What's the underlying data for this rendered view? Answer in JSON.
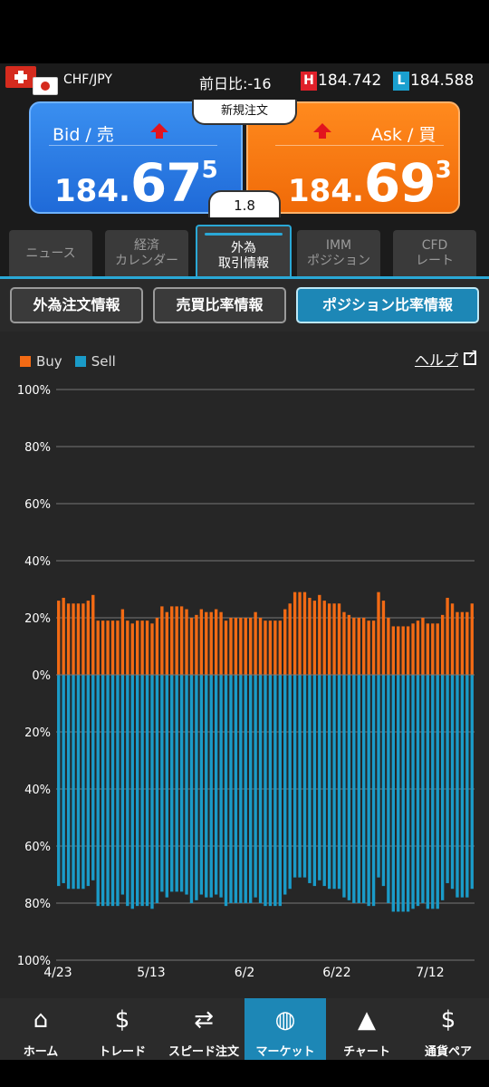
{
  "pair": {
    "name": "CHF/JPY",
    "change_label": "前日比:",
    "change_value": "-16",
    "high_badge": "H",
    "high": "184.742",
    "low_badge": "L",
    "low": "184.588"
  },
  "quote": {
    "bid_label": "Bid / 売",
    "bid_pre": "184.",
    "bid_big": "67",
    "bid_sup": "5",
    "ask_label": "Ask / 買",
    "ask_pre": "184.",
    "ask_big": "69",
    "ask_sup": "3",
    "new_order": "新規注文",
    "spread": "1.8"
  },
  "tabs": [
    {
      "line1": "ニュース",
      "line2": ""
    },
    {
      "line1": "経済",
      "line2": "カレンダー"
    },
    {
      "line1": "外為",
      "line2": "取引情報"
    },
    {
      "line1": "IMM",
      "line2": "ポジション"
    },
    {
      "line1": "CFD",
      "line2": "レート"
    }
  ],
  "subtabs": [
    "外為注文情報",
    "売買比率情報",
    "ポジション比率情報"
  ],
  "legend": {
    "buy": "Buy",
    "sell": "Sell"
  },
  "help_label": "ヘルプ",
  "colors": {
    "buy": "#f26a14",
    "sell": "#1a9bc8",
    "accent": "#1d87b6"
  },
  "chart_data": {
    "type": "bar",
    "x_ticks": [
      "4/23",
      "5/13",
      "6/2",
      "6/22",
      "7/12"
    ],
    "y_ticks_top": [
      "100%",
      "80%",
      "60%",
      "40%",
      "20%",
      "0%"
    ],
    "y_ticks_bottom": [
      "20%",
      "40%",
      "60%",
      "80%",
      "100%"
    ],
    "ylim": [
      -100,
      100
    ],
    "grid": true,
    "series": [
      {
        "name": "Buy",
        "values": [
          26,
          27,
          25,
          25,
          25,
          25,
          26,
          28,
          19,
          19,
          19,
          19,
          19,
          23,
          19,
          18,
          19,
          19,
          19,
          18,
          20,
          24,
          22,
          24,
          24,
          24,
          23,
          20,
          21,
          23,
          22,
          22,
          23,
          22,
          19,
          20,
          20,
          20,
          20,
          20,
          22,
          20,
          19,
          19,
          19,
          19,
          23,
          25,
          29,
          29,
          29,
          27,
          26,
          28,
          26,
          25,
          25,
          25,
          22,
          21,
          20,
          20,
          20,
          19,
          19,
          29,
          26,
          20,
          17,
          17,
          17,
          17,
          18,
          19,
          20,
          18,
          18,
          18,
          21,
          27,
          25,
          22,
          22,
          22,
          25
        ]
      },
      {
        "name": "Sell",
        "values": [
          74,
          73,
          75,
          75,
          75,
          75,
          74,
          72,
          81,
          81,
          81,
          81,
          81,
          77,
          81,
          82,
          81,
          81,
          81,
          82,
          80,
          76,
          78,
          76,
          76,
          76,
          77,
          80,
          79,
          77,
          78,
          78,
          77,
          78,
          81,
          80,
          80,
          80,
          80,
          80,
          78,
          80,
          81,
          81,
          81,
          81,
          77,
          75,
          71,
          71,
          71,
          73,
          74,
          72,
          74,
          75,
          75,
          75,
          78,
          79,
          80,
          80,
          80,
          81,
          81,
          71,
          74,
          80,
          83,
          83,
          83,
          83,
          82,
          81,
          80,
          82,
          82,
          82,
          79,
          73,
          75,
          78,
          78,
          78,
          75
        ]
      }
    ]
  },
  "nav": [
    {
      "label": "ホーム",
      "icon": "home-icon",
      "glyph": "⌂"
    },
    {
      "label": "トレード",
      "icon": "trade-icon",
      "glyph": "$"
    },
    {
      "label": "スピード注文",
      "icon": "speed-order-icon",
      "glyph": "⇄"
    },
    {
      "label": "マーケット",
      "icon": "globe-icon",
      "glyph": "◍"
    },
    {
      "label": "チャート",
      "icon": "chart-icon",
      "glyph": "▲"
    },
    {
      "label": "通貨ペア",
      "icon": "currency-pair-icon",
      "glyph": "$"
    }
  ]
}
